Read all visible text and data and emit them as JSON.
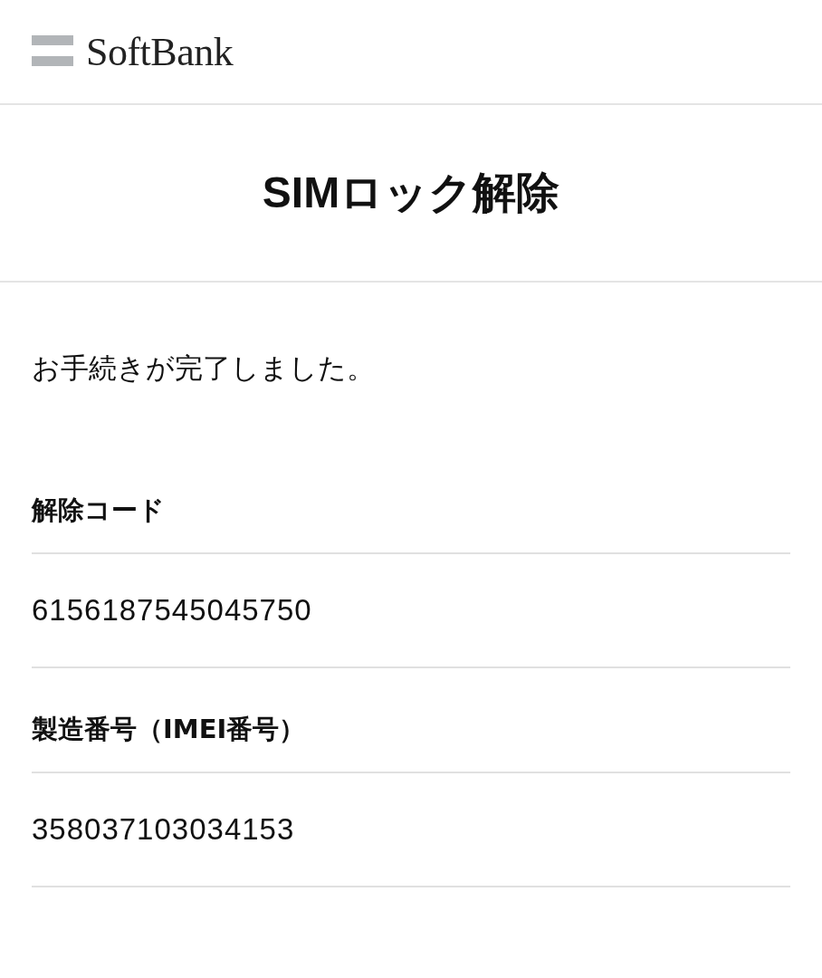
{
  "header": {
    "logo": "SoftBank"
  },
  "page_title": "SIMロック解除",
  "message": "お手続きが完了しました。",
  "fields": [
    {
      "label": "解除コード",
      "value": "6156187545045750"
    },
    {
      "label": "製造番号（IMEI番号）",
      "value": "358037103034153"
    }
  ]
}
